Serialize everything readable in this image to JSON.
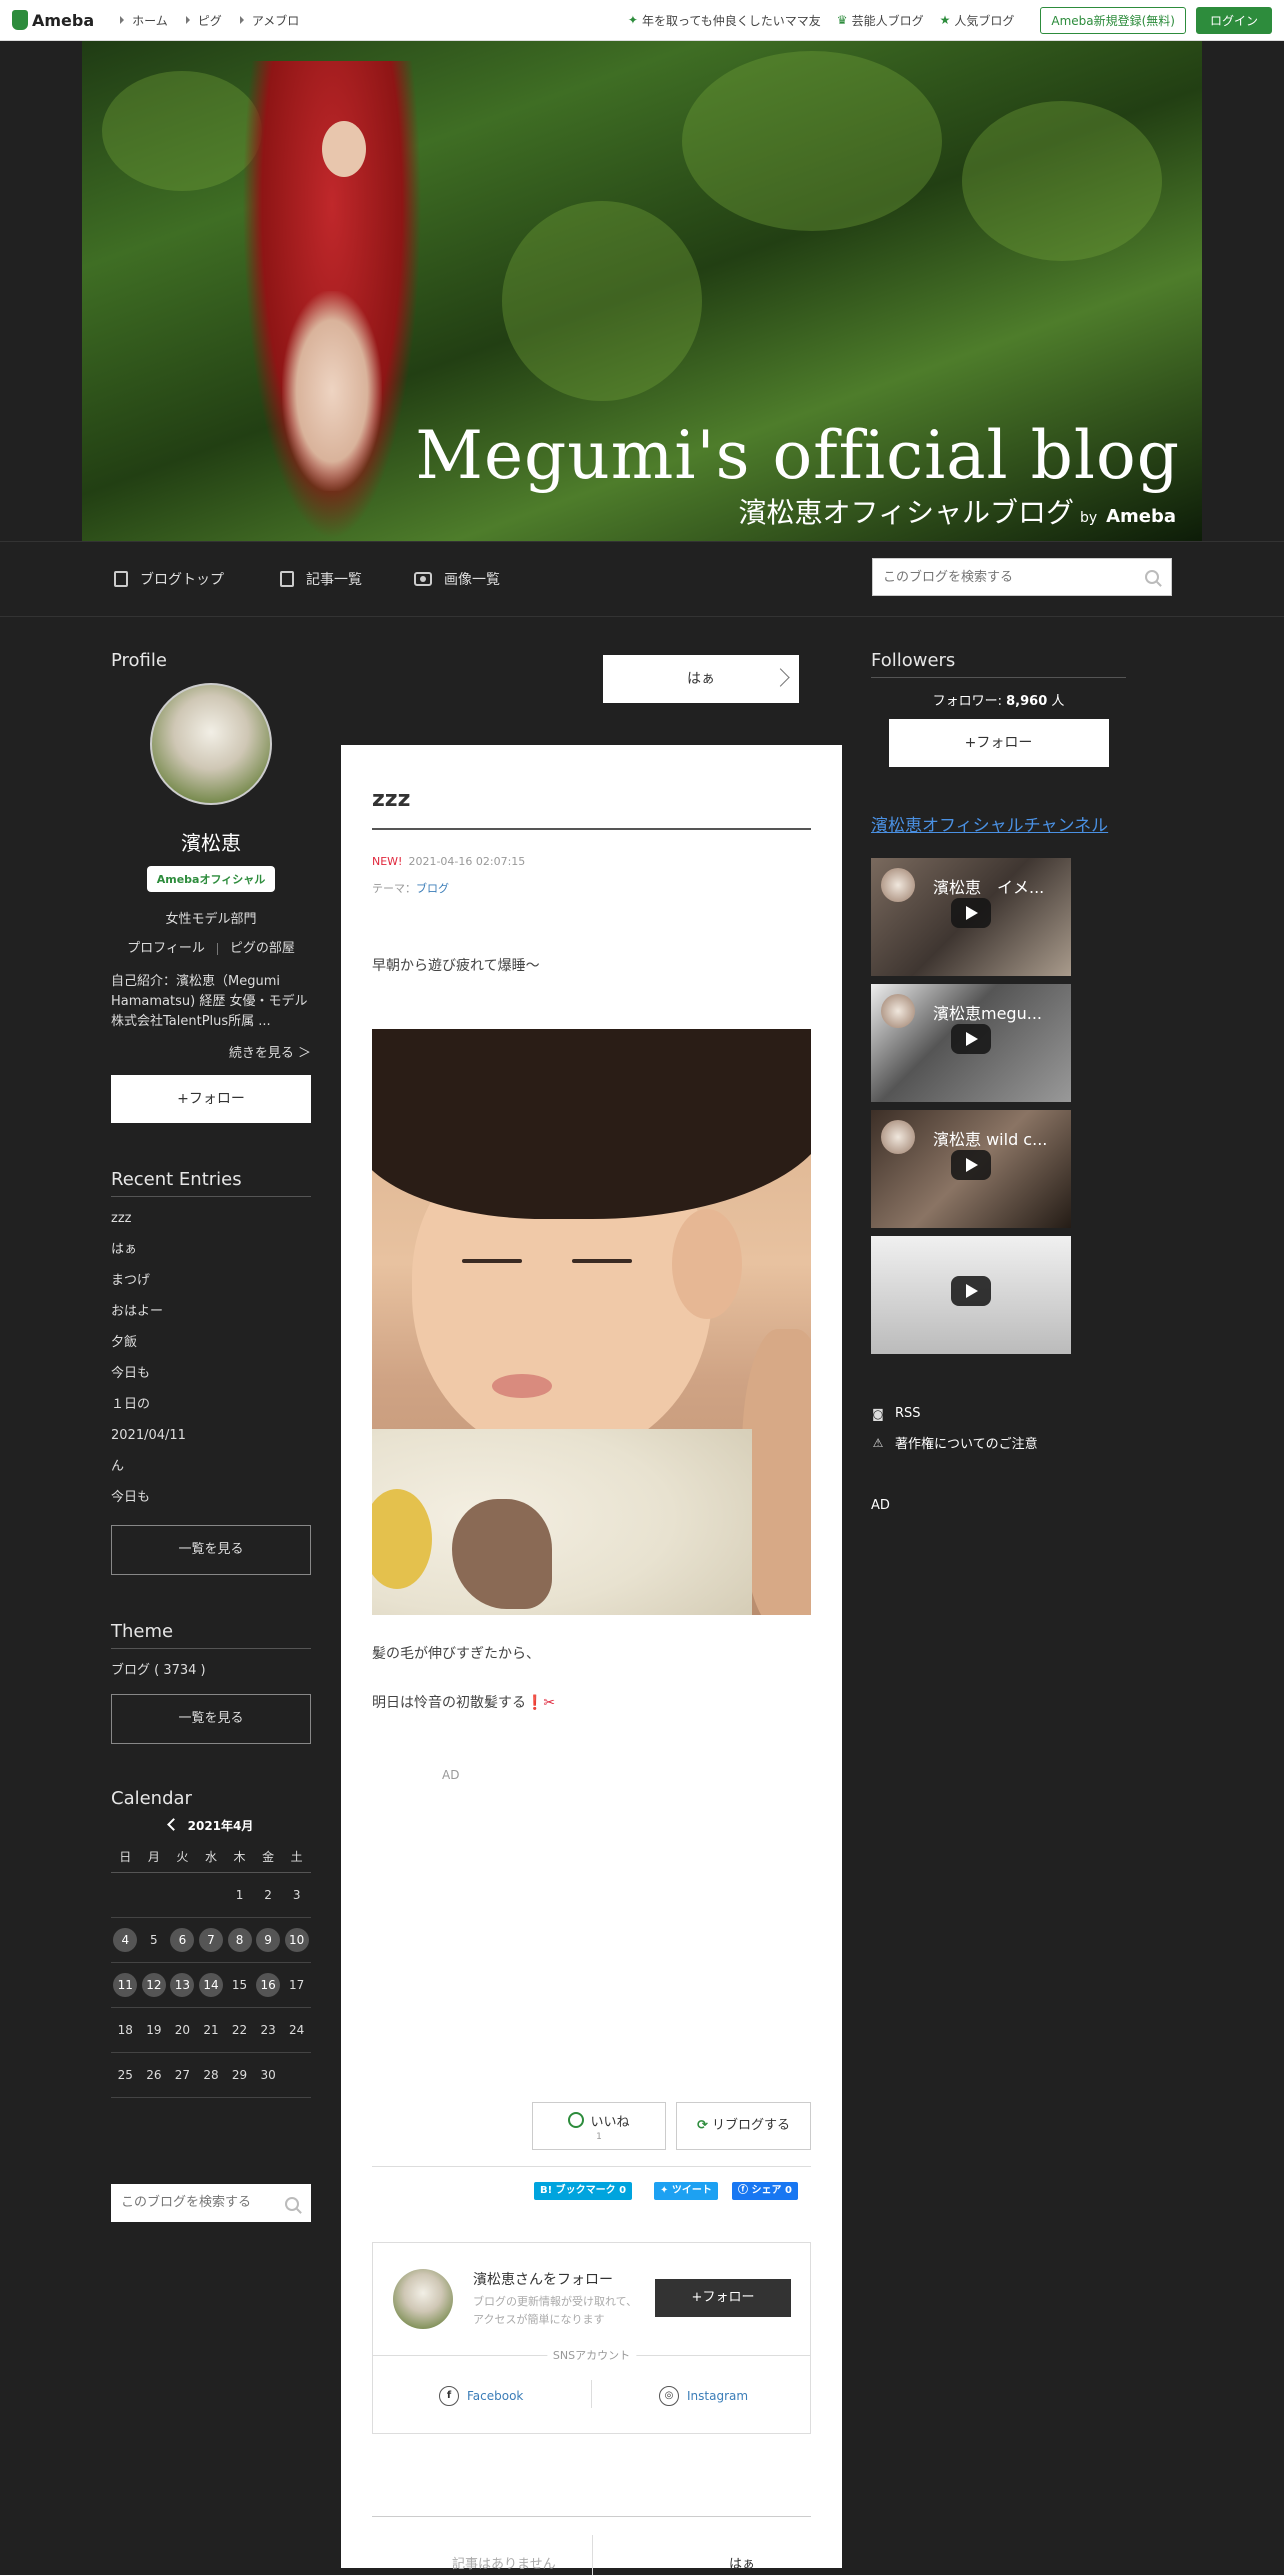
{
  "topbar": {
    "logo": "Ameba",
    "nav": [
      "ホーム",
      "ピグ",
      "アメブロ"
    ],
    "links": [
      "年を取っても仲良くしたいママ友",
      "芸能人ブログ",
      "人気ブログ"
    ],
    "register": "Ameba新規登録(無料)",
    "login": "ログイン"
  },
  "header": {
    "title": "Megumi's official blog",
    "subtitle": "濱松恵オフィシャルブログ",
    "by": "by",
    "brand": "Ameba"
  },
  "blognav": {
    "tabs": [
      "ブログトップ",
      "記事一覧",
      "画像一覧"
    ],
    "search_placeholder": "このブログを検索する"
  },
  "profile": {
    "heading": "Profile",
    "name": "濱松恵",
    "badge": "Amebaオフィシャル",
    "genre": "女性モデル部門",
    "link_profile": "プロフィール",
    "link_pig": "ピグの部屋",
    "intro": "自己紹介：濱松恵（Megumi Hamamatsu) 経歴 女優・モデル 株式会社TalentPlus所属 ...",
    "more": "続きを見る ＞",
    "follow": "+フォロー"
  },
  "recent": {
    "heading": "Recent Entries",
    "items": [
      "zzz",
      "はぁ",
      "まつげ",
      "おはよー",
      "夕飯",
      "今日も",
      "１日の",
      "2021/04/11",
      "ん",
      "今日も"
    ],
    "see_all": "一覧を見る"
  },
  "theme": {
    "heading": "Theme",
    "item": "ブログ ( 3734 )",
    "see_all": "一覧を見る"
  },
  "calendar": {
    "heading": "Calendar",
    "month": "2021年4月",
    "weekdays": [
      "日",
      "月",
      "火",
      "水",
      "木",
      "金",
      "土"
    ],
    "weeks": [
      [
        "",
        "",
        "",
        "",
        "1",
        "2",
        "3"
      ],
      [
        "4",
        "5",
        "6",
        "7",
        "8",
        "9",
        "10"
      ],
      [
        "11",
        "12",
        "13",
        "14",
        "15",
        "16",
        "17"
      ],
      [
        "18",
        "19",
        "20",
        "21",
        "22",
        "23",
        "24"
      ],
      [
        "25",
        "26",
        "27",
        "28",
        "29",
        "30",
        ""
      ]
    ],
    "has_entries": [
      "4",
      "6",
      "7",
      "8",
      "9",
      "10",
      "11",
      "12",
      "13",
      "14",
      "16"
    ]
  },
  "side_search_placeholder": "このブログを検索する",
  "prev_entry": "はぁ",
  "entry": {
    "title": "zzz",
    "new": "NEW!",
    "datetime": "2021-04-16 02:07:15",
    "theme_label": "テーマ：",
    "theme": "ブログ",
    "p0": "早朝から遊び疲れて爆睡～",
    "p1": "髪の毛が伸びすぎたから、",
    "p2": "明日は怜音の初散髪する",
    "p2_emoji": "❗✂",
    "ad": "AD",
    "like": "いいね",
    "like_count": "1",
    "reblog": "リブログする",
    "share": {
      "hatena": "B! ブックマーク  0",
      "tweet": "ツイート",
      "facebook": "シェア 0"
    }
  },
  "followbox": {
    "name": "濱松恵さんをフォロー",
    "desc": "ブログの更新情報が受け取れて、アクセスが簡単になります",
    "button": "+フォロー",
    "sns_label": "SNSアカウント",
    "facebook": "Facebook",
    "instagram": "Instagram"
  },
  "bottom_nav": {
    "left": "記事はありません",
    "right": "はぁ"
  },
  "followers": {
    "heading": "Followers",
    "label": "フォロワー: ",
    "count": "8,960",
    "unit": " 人",
    "follow": "+フォロー"
  },
  "channel": "濱松恵オフィシャルチャンネル",
  "videos": [
    {
      "title": "濱松恵　イメ..."
    },
    {
      "title": "濱松恵megu..."
    },
    {
      "title": "濱松恵 wild c..."
    },
    {
      "title": ""
    }
  ],
  "right_links": {
    "rss": "RSS",
    "copyright": "著作権についてのご注意"
  },
  "right_ad": "AD",
  "colors": {
    "accent": "#2d8c3c",
    "background": "#212121",
    "link": "#4a90e2",
    "new": "#e0283d"
  }
}
